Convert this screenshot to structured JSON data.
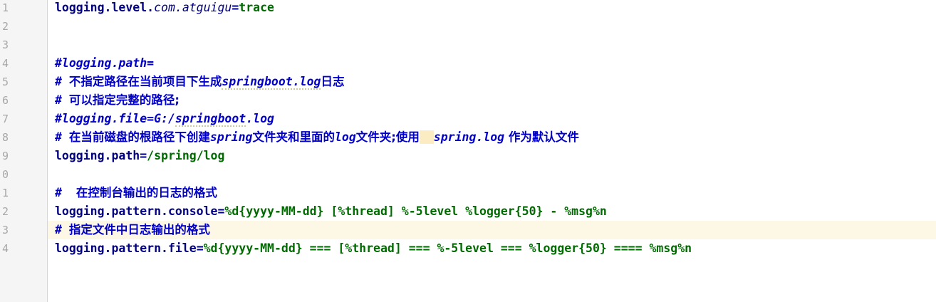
{
  "gutter": {
    "line_numbers": [
      "1",
      "2",
      "3",
      "4",
      "5",
      "6",
      "7",
      "8",
      "9",
      "0",
      "1",
      "2",
      "3",
      "4"
    ]
  },
  "lines": [
    {
      "key_a": "logging.level.",
      "key_b": "com.atguigu",
      "eq": "=",
      "value": "trace"
    },
    {},
    {},
    {
      "text": "#logging.path="
    },
    {
      "hash": "# ",
      "a": "不指定路径在当前项目下生成",
      "b": "springboot.log",
      "c": "日志"
    },
    {
      "hash": "# ",
      "a": "可以指定完整的路径;"
    },
    {
      "a": "#logging.file=G:/",
      "b": "springboot",
      "c": ".log"
    },
    {
      "hash": "# ",
      "a": "在当前磁盘的根路径下创建",
      "b": "spring",
      "c": "文件夹和里面的",
      "d": "log",
      "e": "文件夹;使用",
      "f": "spring.log",
      "g": " 作为默认文件"
    },
    {
      "key": "logging.path",
      "eq": "=",
      "value": "/spring/log"
    },
    {},
    {
      "hash": "#  ",
      "a": "在控制台输出的日志的格式"
    },
    {
      "key": "logging.pattern.console",
      "eq": "=",
      "value": "%d{yyyy-MM-dd} [%thread] %-5level %logger{50} - %msg%n"
    },
    {
      "hash": "# ",
      "a": "指定文件中日志输出的格式"
    },
    {
      "key": "logging.pattern.file",
      "eq": "=",
      "value": "%d{yyyy-MM-dd} === [%thread] === %-5level === %logger{50} ==== %msg%n"
    }
  ],
  "current_line_index": 12
}
